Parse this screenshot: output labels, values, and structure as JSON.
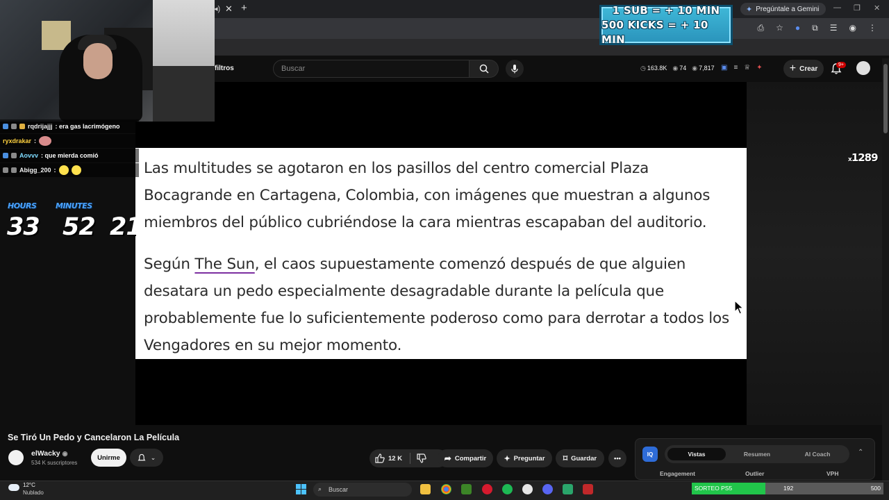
{
  "browser": {
    "gemini_label": "Pregúntale a Gemini"
  },
  "promo": {
    "line1": "1 SUB = + 10 MIN",
    "line2": "500 KICKS = + 10 MIN"
  },
  "youtube": {
    "filters_label": "filtros",
    "search_placeholder": "Buscar",
    "stats": {
      "views": "163.8K",
      "viewers": "74",
      "other": "7,817"
    },
    "create_label": "Crear",
    "notifications": "9+"
  },
  "article": {
    "paragraph1": "Las multitudes se agotaron en los pasillos del centro comercial Plaza Bocagrande en Cartagena, Colombia, con imágenes que muestran a algunos miembros del público cubriéndose la cara mientras escapaban del auditorio.",
    "p2_before": "Según ",
    "p2_link": "The Sun",
    "p2_after": ", el caos supuestamente comenzó después de que alguien desatara un pedo especialmente desagradable durante la película que probablemente fue lo suficientemente poderoso como para derrotar a todos los Vengadores en su mejor momento."
  },
  "overlay": {
    "multiplier_x": "x",
    "multiplier_value": "1289",
    "chat": [
      {
        "user": "rqdrijajjj",
        "message": ": era gas lacrimógeno"
      },
      {
        "user": "ryxdrakar",
        "message": ":"
      },
      {
        "user": "Aovvv",
        "message": ": que mierda comió"
      },
      {
        "user": "Abigg_200",
        "message": ":"
      }
    ],
    "timer": {
      "hours_label": "HOURS",
      "minutes_label": "MINUTES",
      "hours": "33",
      "minutes": "52",
      "seconds": "21"
    }
  },
  "video": {
    "title": "Se Tiró Un Pedo y Cancelaron La Película",
    "channel": "elWacky",
    "subscribers": "534 K suscriptores",
    "join_label": "Unirme",
    "likes": "12 K",
    "share_label": "Compartir",
    "ask_label": "Preguntar",
    "save_label": "Guardar"
  },
  "analytics_panel": {
    "logo": "IQ",
    "tabs": [
      "Vistas",
      "Resumen",
      "AI Coach"
    ],
    "columns": [
      "Engagement",
      "Outlier",
      "VPH"
    ]
  },
  "taskbar": {
    "temperature": "12°C",
    "weather": "Nublado",
    "search_label": "Buscar",
    "sorteo_label": "SORTEO PS5",
    "sorteo_current": "192",
    "sorteo_goal": "500",
    "sorteo_progress": 0.384
  }
}
